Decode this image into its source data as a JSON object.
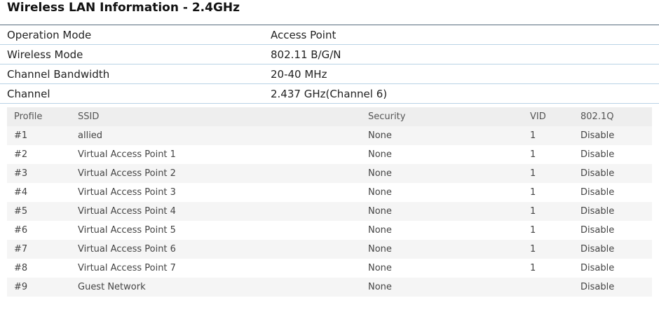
{
  "title": "Wireless LAN Information - 2.4GHz",
  "info": [
    {
      "label": "Operation Mode",
      "value": "Access Point"
    },
    {
      "label": "Wireless Mode",
      "value": "802.11 B/G/N"
    },
    {
      "label": "Channel Bandwidth",
      "value": "20-40 MHz"
    },
    {
      "label": "Channel",
      "value": "2.437 GHz(Channel 6)"
    }
  ],
  "profiles": {
    "headers": {
      "profile": "Profile",
      "ssid": "SSID",
      "security": "Security",
      "vid": "VID",
      "q": "802.1Q"
    },
    "rows": [
      {
        "profile": "#1",
        "ssid": "allied",
        "security": "None",
        "vid": "1",
        "q": "Disable"
      },
      {
        "profile": "#2",
        "ssid": "Virtual Access Point 1",
        "security": "None",
        "vid": "1",
        "q": "Disable"
      },
      {
        "profile": "#3",
        "ssid": "Virtual Access Point 2",
        "security": "None",
        "vid": "1",
        "q": "Disable"
      },
      {
        "profile": "#4",
        "ssid": "Virtual Access Point 3",
        "security": "None",
        "vid": "1",
        "q": "Disable"
      },
      {
        "profile": "#5",
        "ssid": "Virtual Access Point 4",
        "security": "None",
        "vid": "1",
        "q": "Disable"
      },
      {
        "profile": "#6",
        "ssid": "Virtual Access Point 5",
        "security": "None",
        "vid": "1",
        "q": "Disable"
      },
      {
        "profile": "#7",
        "ssid": "Virtual Access Point 6",
        "security": "None",
        "vid": "1",
        "q": "Disable"
      },
      {
        "profile": "#8",
        "ssid": "Virtual Access Point 7",
        "security": "None",
        "vid": "1",
        "q": "Disable"
      },
      {
        "profile": "#9",
        "ssid": "Guest Network",
        "security": "None",
        "vid": "",
        "q": "Disable"
      }
    ]
  }
}
